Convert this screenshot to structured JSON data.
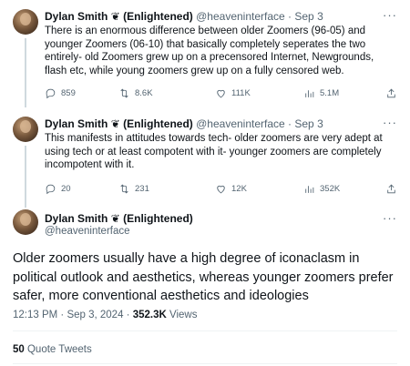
{
  "author": {
    "name": "Dylan Smith",
    "emoji": "❦",
    "tag": "(Enlightened)",
    "handle": "@heaveninterface"
  },
  "tweets": [
    {
      "date": "· Sep 3",
      "text": "There is an enormous difference between older Zoomers (96-05) and younger Zoomers (06-10) that basically completely seperates the two entirely- old Zoomers grew up on a precensored Internet, Newgrounds, flash etc, while young zoomers grew up on a fully censored web.",
      "stats": {
        "replies": "859",
        "reposts": "8.6K",
        "likes": "111K",
        "views": "5.1M"
      }
    },
    {
      "date": "· Sep 3",
      "text": "This manifests in attitudes towards tech- older zoomers are very adept at using tech or at least compotent with it- younger zoomers are completely incompotent with it.",
      "stats": {
        "replies": "20",
        "reposts": "231",
        "likes": "12K",
        "views": "352K"
      }
    }
  ],
  "focus": {
    "text": "Older zoomers usually have a high degree of iconaclasm in political outlook and aesthetics, whereas younger zoomers prefer safer, more conventional aesthetics and ideologies",
    "time": "12:13 PM · Sep 3, 2024 · ",
    "views_count": "352.3K",
    "views_label": " Views",
    "quote_count": "50",
    "quote_label": " Quote Tweets"
  },
  "icons": {
    "more": "more-dots-icon",
    "reply": "reply-icon",
    "repost": "repost-icon",
    "like": "heart-icon",
    "views": "views-icon",
    "share": "share-icon"
  },
  "more_glyph": "···"
}
